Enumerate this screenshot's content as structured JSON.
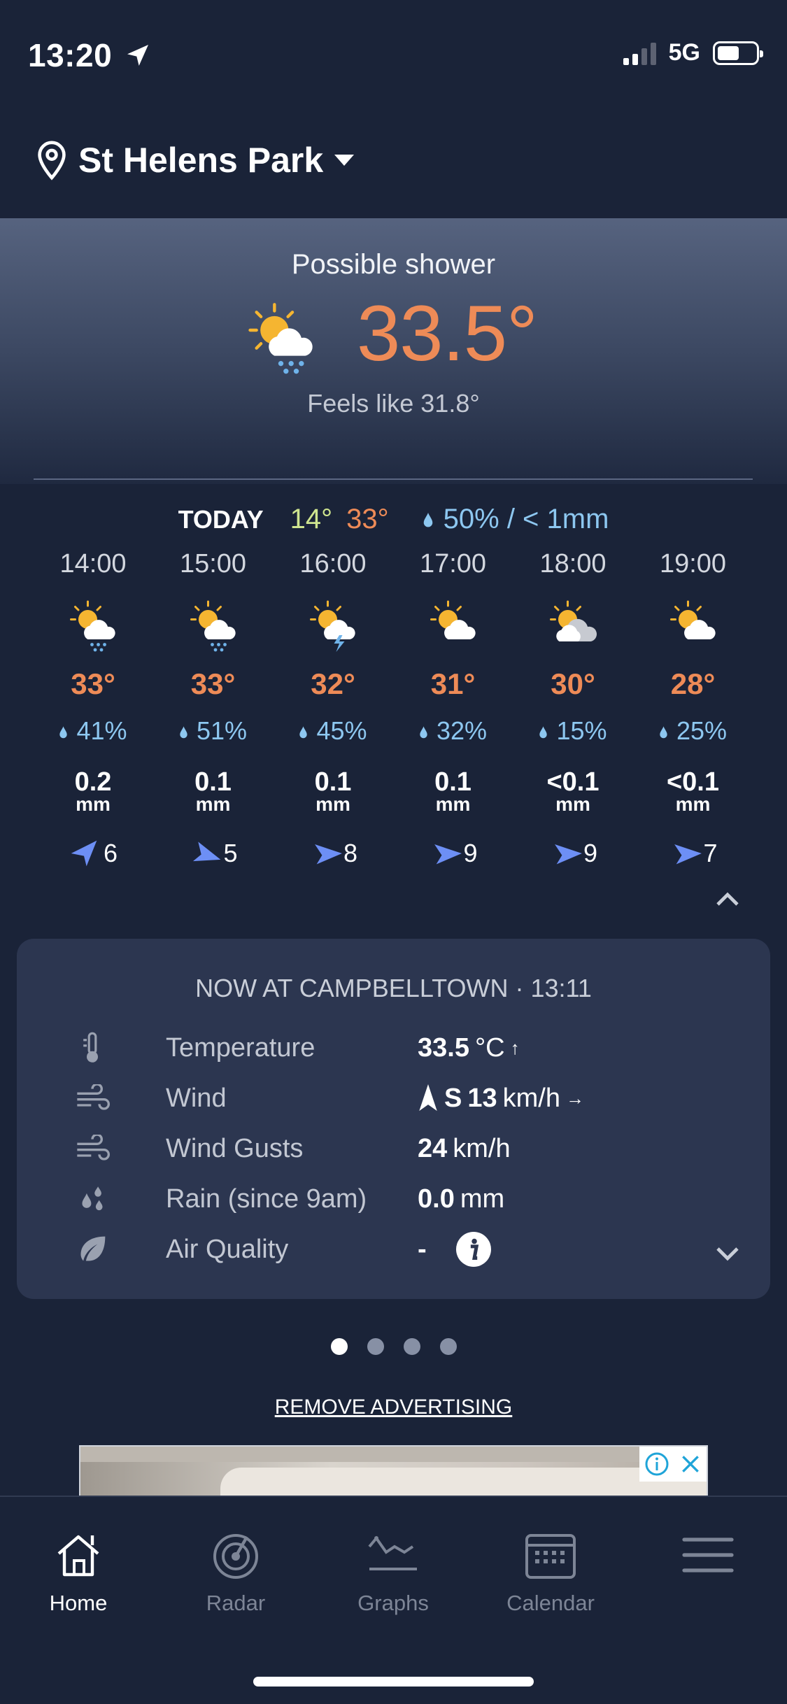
{
  "status_bar": {
    "time": "13:20",
    "network": "5G",
    "icons": [
      "location-arrow-icon",
      "signal-icon",
      "battery-icon"
    ]
  },
  "location": {
    "name": "St Helens Park",
    "icons": [
      "pin-icon",
      "caret-down-icon"
    ]
  },
  "current": {
    "condition": "Possible shower",
    "temperature": "33.5°",
    "feels_like": "Feels like 31.8°",
    "icon": "sun-cloud-rain-icon"
  },
  "today": {
    "label": "TODAY",
    "min": "14°",
    "max": "33°",
    "rain": "50% / < 1mm"
  },
  "hourly": [
    {
      "time": "14:00",
      "icon": "sun-cloud-rain-icon",
      "temp": "33°",
      "chance": "41%",
      "amount": "0.2",
      "unit": "mm",
      "wind": "6",
      "wind_dir_deg": 45
    },
    {
      "time": "15:00",
      "icon": "sun-cloud-rain-icon",
      "temp": "33°",
      "chance": "51%",
      "amount": "0.1",
      "unit": "mm",
      "wind": "5",
      "wind_dir_deg": 110
    },
    {
      "time": "16:00",
      "icon": "sun-cloud-storm-icon",
      "temp": "32°",
      "chance": "45%",
      "amount": "0.1",
      "unit": "mm",
      "wind": "8",
      "wind_dir_deg": 90
    },
    {
      "time": "17:00",
      "icon": "sun-cloud-icon",
      "temp": "31°",
      "chance": "32%",
      "amount": "0.1",
      "unit": "mm",
      "wind": "9",
      "wind_dir_deg": 90
    },
    {
      "time": "18:00",
      "icon": "cloud-sun-icon",
      "temp": "30°",
      "chance": "15%",
      "amount": "<0.1",
      "unit": "mm",
      "wind": "9",
      "wind_dir_deg": 90
    },
    {
      "time": "19:00",
      "icon": "sun-cloud-icon",
      "temp": "28°",
      "chance": "25%",
      "amount": "<0.1",
      "unit": "mm",
      "wind": "7",
      "wind_dir_deg": 90
    }
  ],
  "observations": {
    "title": "NOW AT CAMPBELLTOWN · 13:11",
    "rows": [
      {
        "label": "Temperature",
        "value": "33.5",
        "unit": "°C",
        "trend": "↑",
        "icon": "thermometer-icon"
      },
      {
        "label": "Wind",
        "direction": "S",
        "value": "13",
        "unit": "km/h",
        "trend": "→",
        "icon": "wind-icon"
      },
      {
        "label": "Wind Gusts",
        "value": "24",
        "unit": "km/h",
        "icon": "wind-gust-icon"
      },
      {
        "label": "Rain (since 9am)",
        "value": "0.0",
        "unit": "mm",
        "icon": "rain-drops-icon"
      },
      {
        "label": "Air Quality",
        "value": "-",
        "icon": "leaf-icon"
      }
    ]
  },
  "pager": {
    "count": 4,
    "active": 0
  },
  "remove_advertising": "REMOVE ADVERTISING",
  "tabs": [
    {
      "label": "Home",
      "icon": "home-icon",
      "active": true
    },
    {
      "label": "Radar",
      "icon": "radar-icon",
      "active": false
    },
    {
      "label": "Graphs",
      "icon": "graph-icon",
      "active": false
    },
    {
      "label": "Calendar",
      "icon": "calendar-icon",
      "active": false
    },
    {
      "label": "",
      "icon": "menu-icon",
      "active": false
    }
  ],
  "colors": {
    "background": "#1a2338",
    "accent_temp": "#ee8b57",
    "min_temp": "#cfe58f",
    "rain": "#8dc7f0",
    "wind_arrow": "#6d8ff5"
  }
}
